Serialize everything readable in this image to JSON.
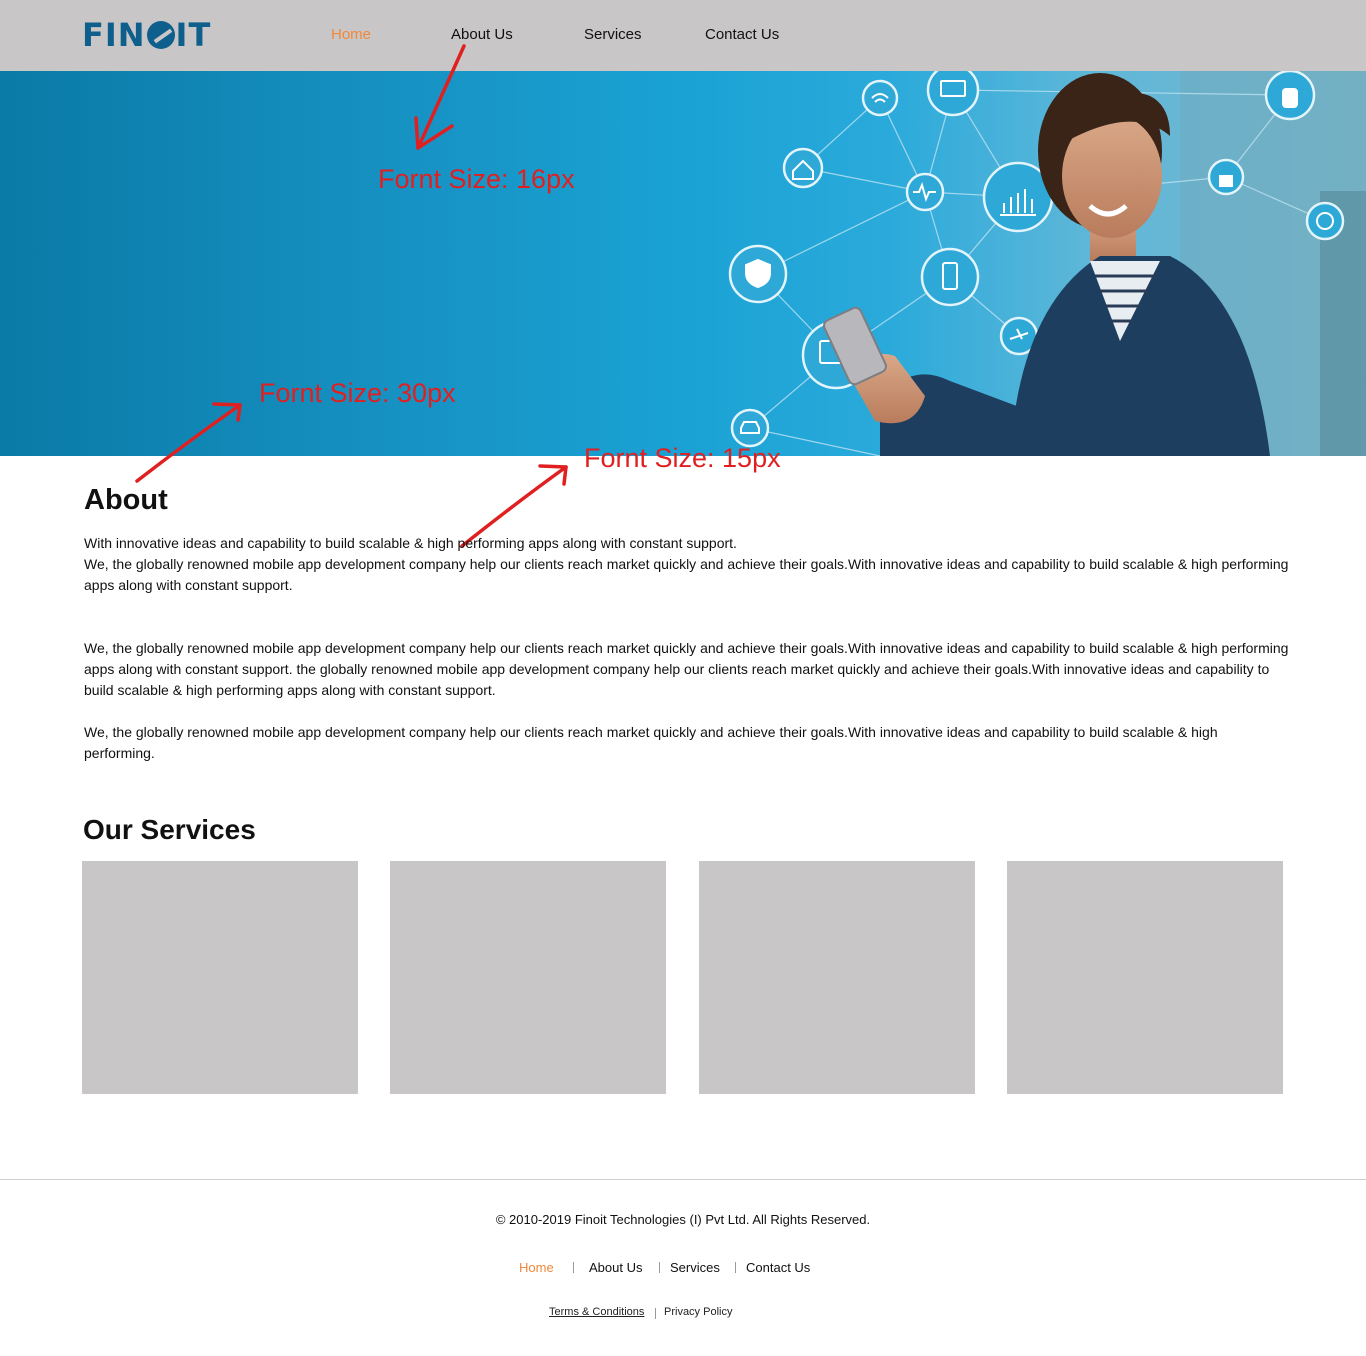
{
  "header": {
    "logo": "FINOIT",
    "nav": [
      {
        "label": "Home",
        "active": true
      },
      {
        "label": "About Us",
        "active": false
      },
      {
        "label": "Services",
        "active": false
      },
      {
        "label": "Contact Us",
        "active": false
      }
    ]
  },
  "annotations": {
    "nav_font": "Fornt Size: 16px",
    "heading_font": "Fornt Size: 30px",
    "body_font": "Fornt Size: 15px"
  },
  "about": {
    "title": "About",
    "p1_line1": "With innovative ideas and capability to build scalable & high performing apps along with constant support.",
    "p1_line2": "We, the globally renowned mobile app development company help our clients reach market quickly and achieve their goals.With innovative ideas and capability to build scalable & high performing apps along with constant support.",
    "p2": "We, the globally renowned mobile app development company help our clients reach market quickly and achieve their goals.With innovative ideas and capability to build scalable & high performing apps along with constant support.  the globally renowned mobile app development company help our clients reach market quickly and achieve their goals.With innovative ideas and capability to build scalable & high performing apps along with constant support.",
    "p3": "We, the globally renowned mobile app development company help our clients reach market quickly and achieve their goals.With innovative ideas and capability to build scalable & high performing."
  },
  "services": {
    "title": "Our Services",
    "cards": [
      "",
      "",
      "",
      ""
    ]
  },
  "footer": {
    "copyright": "© 2010-2019 Finoit Technologies (I) Pvt Ltd. All Rights Reserved.",
    "nav": [
      "Home",
      "About Us",
      "Services",
      "Contact Us"
    ],
    "terms": "Terms & Conditions",
    "privacy": "Privacy Policy"
  },
  "colors": {
    "accent": "#f0883a",
    "header_bg": "#c8c6c7",
    "brand": "#0f5f8d",
    "annotation": "#e02020"
  }
}
